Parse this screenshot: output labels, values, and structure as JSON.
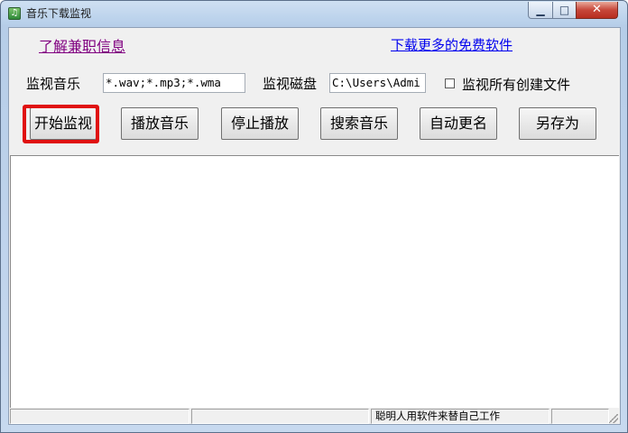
{
  "window": {
    "title": "音乐下载监视",
    "app_icon": "music-note-icon",
    "controls": {
      "minimize": "minimize-icon",
      "maximize": "maximize-icon",
      "close": "close-icon"
    }
  },
  "links": {
    "part_time": "了解兼职信息",
    "download_more": "下载更多的免费软件"
  },
  "form": {
    "music_label": "监视音乐",
    "music_filter_value": "*.wav;*.mp3;*.wma",
    "disk_label": "监视磁盘",
    "disk_path_value": "C:\\Users\\Admi",
    "monitor_all_label": "监视所有创建文件",
    "monitor_all_checked": false
  },
  "buttons": {
    "start": "开始监视",
    "play": "播放音乐",
    "stop": "停止播放",
    "search": "搜索音乐",
    "rename": "自动更名",
    "save_as": "另存为"
  },
  "highlight_color": "#e01010",
  "statusbar": {
    "pane1": "",
    "pane2": "",
    "pane3": "聪明人用软件来替自己工作",
    "pane4": ""
  }
}
